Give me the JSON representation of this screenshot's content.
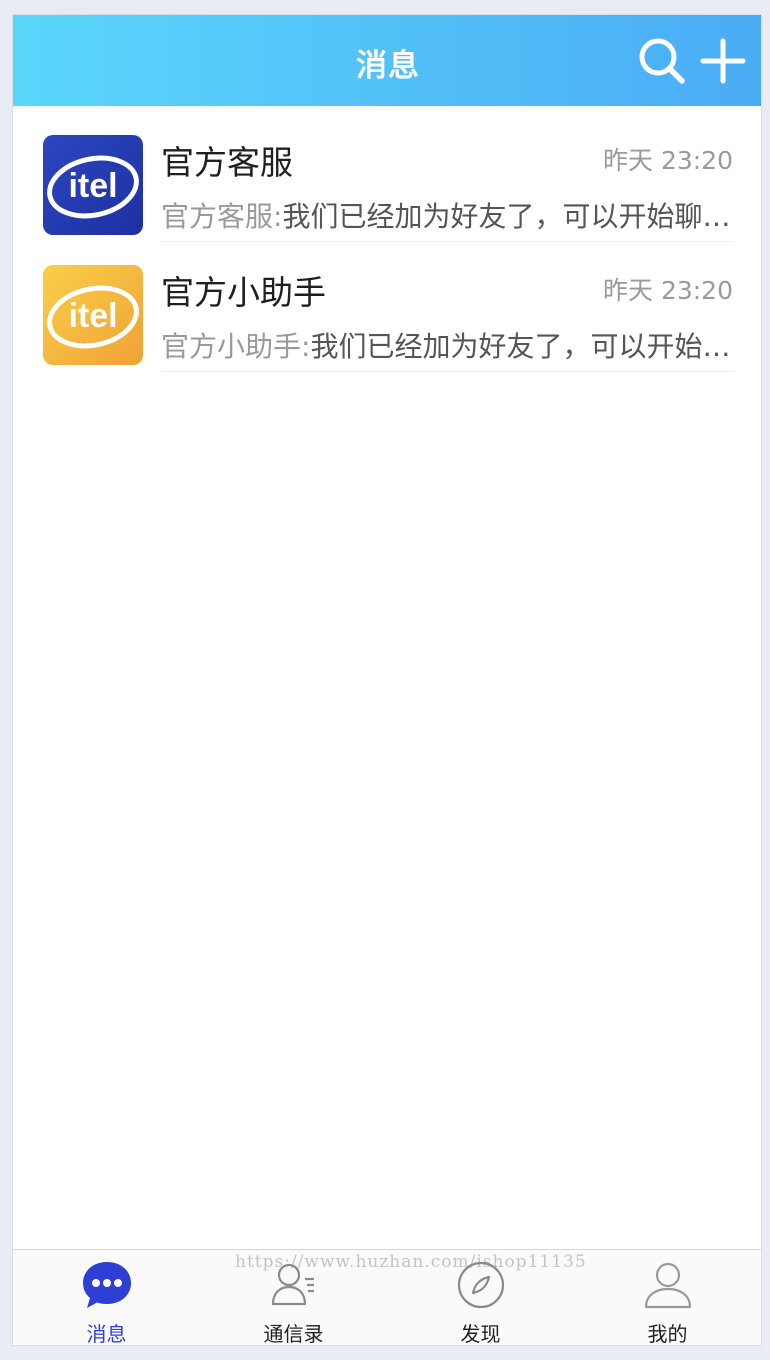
{
  "header": {
    "title": "消息",
    "search_icon": "search-icon",
    "add_icon": "plus-icon"
  },
  "conversations": [
    {
      "name": "官方客服",
      "time": "昨天 23:20",
      "sender": "官方客服:",
      "message": "我们已经加为好友了，可以开始聊天了",
      "avatar_text": "itel",
      "avatar_color": "#2a40b4"
    },
    {
      "name": "官方小助手",
      "time": "昨天 23:20",
      "sender": "官方小助手:",
      "message": "我们已经加为好友了，可以开始聊天了",
      "avatar_text": "itel",
      "avatar_color": "#f3b43d"
    }
  ],
  "tabbar": {
    "watermark": "https://www.huzhan.com/ishop11135",
    "tabs": [
      {
        "label": "消息",
        "icon": "chat-bubble-icon",
        "active": true
      },
      {
        "label": "通信录",
        "icon": "contacts-icon",
        "active": false
      },
      {
        "label": "发现",
        "icon": "compass-icon",
        "active": false
      },
      {
        "label": "我的",
        "icon": "person-icon",
        "active": false
      }
    ]
  },
  "colors": {
    "header_start": "#5bd6fb",
    "header_end": "#4aacf5",
    "active_tab": "#2f3fd6"
  }
}
